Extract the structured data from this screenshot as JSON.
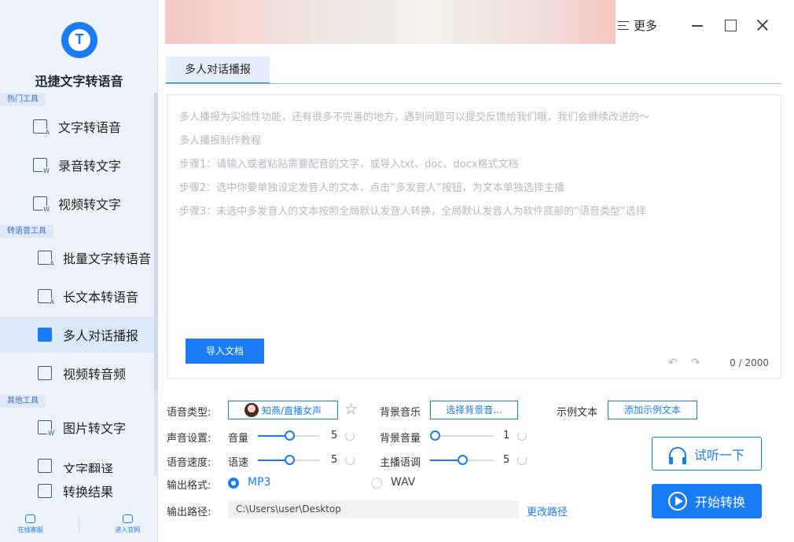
{
  "app": {
    "title": "迅捷文字转语音"
  },
  "sidebar": {
    "sections": [
      {
        "label": "热门工具"
      },
      {
        "label": "转语音工具"
      },
      {
        "label": "其他工具"
      }
    ],
    "items": [
      {
        "label": "文字转语音",
        "icon": "text-to-speech-icon",
        "glyph": "A"
      },
      {
        "label": "录音转文字",
        "icon": "recording-to-text-icon",
        "glyph": "W"
      },
      {
        "label": "视频转文字",
        "icon": "video-to-text-icon",
        "glyph": "W"
      },
      {
        "label": "批量文字转语音",
        "icon": "batch-text-to-speech-icon",
        "glyph": "A"
      },
      {
        "label": "长文本转语音",
        "icon": "long-text-to-speech-icon",
        "glyph": "A"
      },
      {
        "label": "多人对话播报",
        "icon": "multi-speaker-icon",
        "glyph": "",
        "active": true
      },
      {
        "label": "视频转音频",
        "icon": "video-to-audio-icon",
        "glyph": ""
      },
      {
        "label": "图片转文字",
        "icon": "image-to-text-icon",
        "glyph": "W"
      },
      {
        "label": "文字翻译",
        "icon": "text-translate-icon",
        "glyph": ""
      },
      {
        "label": "转换结果",
        "icon": "conversion-results-icon",
        "glyph": ""
      }
    ],
    "bottom_links": [
      {
        "label": "在线客服",
        "icon": "headset-icon"
      },
      {
        "label": "进入官网",
        "icon": "monitor-icon"
      }
    ]
  },
  "titlebar": {
    "more_label": "更多"
  },
  "tabs": [
    {
      "label": "多人对话播报",
      "active": true
    }
  ],
  "editor": {
    "placeholder_lines": [
      "多人播报为实验性功能，还有很多不完善的地方，遇到问题可以提交反馈给我们哦，我们会继续改进的～",
      "多人播报制作教程",
      "步骤1：请输入或者粘贴需要配音的文字，或导入txt、doc、docx格式文档",
      "步骤2：选中你要单独设定发音人的文本，点击“多发音人”按钮，为文本单独选择主播",
      "步骤3：未选中多发音人的文本按照全局默认发音人转换，全局默认发音人为软件底部的“语音类型”选择"
    ],
    "import_label": "导入文档",
    "char_count": "0 / 2000"
  },
  "settings": {
    "voice_type_label": "语音类型:",
    "voice_name": "知燕/直播女声",
    "bg_music_label": "背景音乐",
    "bg_music_button": "选择背景音...",
    "sample_text_label": "示例文本",
    "sample_text_button": "添加示例文本",
    "sound_settings_label": "声音设置:",
    "volume_label": "音量",
    "volume_value": "5",
    "volume_fraction": 0.5,
    "bg_volume_label": "背景音量",
    "bg_volume_value": "1",
    "bg_volume_fraction": 0.0,
    "speed_section_label": "语音速度:",
    "speed_label": "语速",
    "speed_value": "5",
    "speed_fraction": 0.5,
    "pitch_label": "主播语调",
    "pitch_value": "5",
    "pitch_fraction": 0.5,
    "format_label": "输出格式:",
    "format_options": [
      "MP3",
      "WAV"
    ],
    "format_selected": "MP3",
    "path_label": "输出路径:",
    "path_value": "C:\\Users\\user\\Desktop",
    "change_path_label": "更改路径"
  },
  "actions": {
    "preview_label": "试听一下",
    "start_label": "开始转换"
  },
  "colors": {
    "accent": "#1a7cf5",
    "sidebar_bg": "#eef2f9",
    "active_item_bg": "#dce8fb"
  }
}
